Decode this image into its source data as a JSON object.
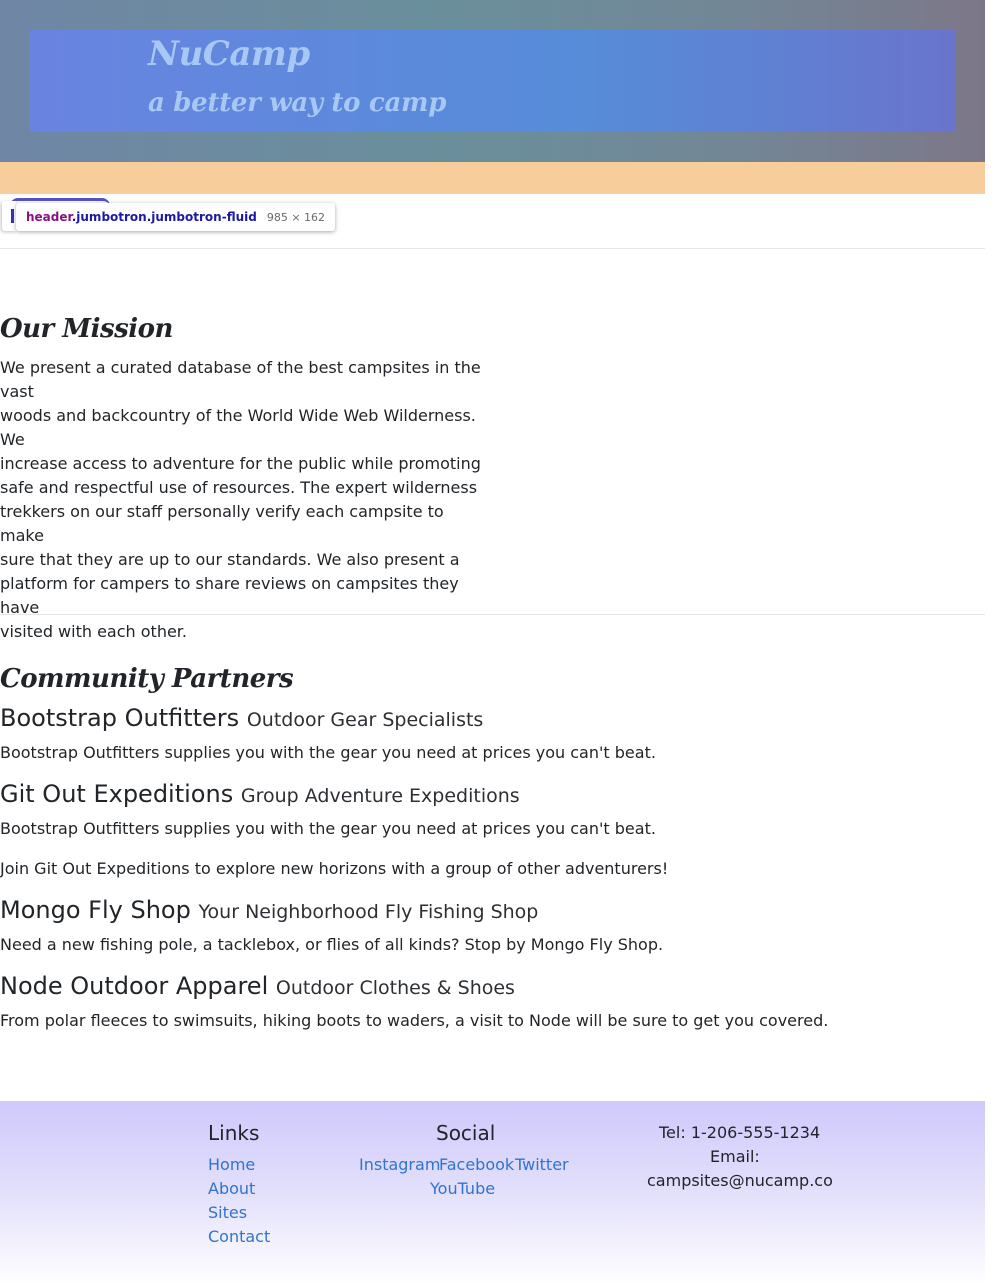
{
  "header": {
    "title": "NuCamp",
    "tagline": "a better way to camp"
  },
  "inspector": {
    "selector_tag": "header",
    "selector_classes": ".jumbotron.jumbotron-fluid",
    "size": "985 × 162"
  },
  "mission": {
    "heading": "Our Mission",
    "lines": [
      "We present a curated database of the best campsites in the vast",
      "woods and backcountry of the World Wide Web Wilderness. We",
      "increase access to adventure for the public while promoting",
      "safe and respectful use of resources. The expert wilderness",
      "trekkers on our staff personally verify each campsite to make",
      "sure that they are up to our standards. We also present a",
      "platform for campers to share reviews on campsites they have",
      "visited with each other."
    ]
  },
  "partners": {
    "heading": "Community Partners",
    "items": [
      {
        "name": "Bootstrap Outfitters",
        "subtitle": "Outdoor Gear Specialists",
        "descriptions": [
          "Bootstrap Outfitters supplies you with the gear you need at prices you can't beat."
        ]
      },
      {
        "name": "Git Out Expeditions",
        "subtitle": "Group Adventure Expeditions",
        "descriptions": [
          "Bootstrap Outfitters supplies you with the gear you need at prices you can't beat.",
          "Join Git Out Expeditions to explore new horizons with a group of other adventurers!"
        ]
      },
      {
        "name": "Mongo Fly Shop",
        "subtitle": "Your Neighborhood Fly Fishing Shop",
        "descriptions": [
          "Need a new fishing pole, a tacklebox, or flies of all kinds? Stop by Mongo Fly Shop."
        ]
      },
      {
        "name": "Node Outdoor Apparel",
        "subtitle": "Outdoor Clothes & Shoes",
        "descriptions": [
          "From polar fleeces to swimsuits, hiking boots to waders, a visit to Node will be sure to get you covered."
        ]
      }
    ]
  },
  "footer": {
    "links_title": "Links",
    "links": [
      "Home",
      "About",
      "Sites",
      "Contact"
    ],
    "social_title": "Social",
    "social": [
      "Instagram",
      "Facebook",
      "Twitter",
      "YouTube"
    ],
    "contact": {
      "tel": "Tel: 1-206-555-1234",
      "email_label": "Email:",
      "email": "campsites@nucamp.co"
    }
  },
  "colors": {
    "nav_strip": "#f8cd9c",
    "link": "#2f74d0",
    "brand_text": "#a8c8f4"
  }
}
